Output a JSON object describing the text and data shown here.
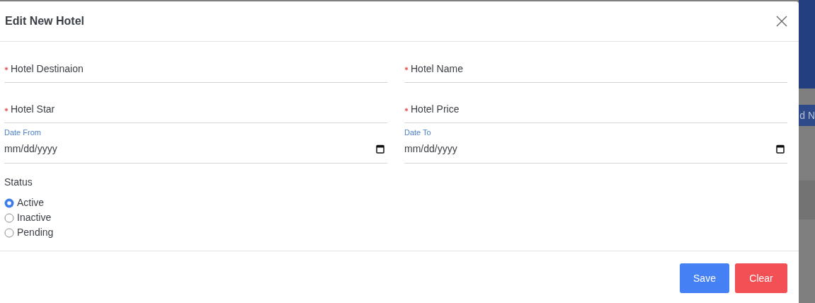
{
  "dialog": {
    "title": "Edit New Hotel"
  },
  "fields": [
    {
      "kind": "text",
      "label": "Hotel Destinaion",
      "required": true
    },
    {
      "kind": "text",
      "label": "Hotel Name",
      "required": true
    },
    {
      "kind": "text",
      "label": "Hotel Star",
      "required": true
    },
    {
      "kind": "text",
      "label": "Hotel Price",
      "required": true
    },
    {
      "kind": "date",
      "label": "Date From",
      "placeholder": "mm/dd/yyyy"
    },
    {
      "kind": "date",
      "label": "Date To",
      "placeholder": "mm/dd/yyyy"
    }
  ],
  "status": {
    "label": "Status",
    "options": [
      {
        "label": "Active",
        "selected": true
      },
      {
        "label": "Inactive",
        "selected": false
      },
      {
        "label": "Pending",
        "selected": false
      }
    ]
  },
  "buttons": [
    {
      "kind": "primary",
      "label": "Save"
    },
    {
      "kind": "danger",
      "label": "Clear"
    }
  ],
  "background": {
    "fragment": "d N"
  }
}
